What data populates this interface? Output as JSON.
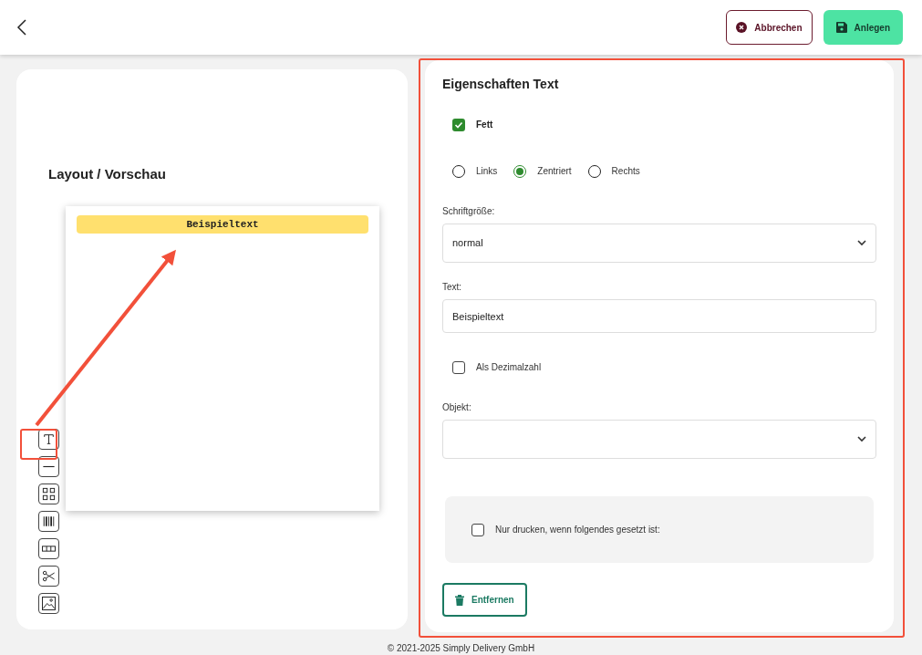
{
  "header": {
    "buttons": [
      {
        "kind": "cancel",
        "label": "Abbrechen"
      },
      {
        "kind": "save",
        "label": "Anlegen"
      }
    ]
  },
  "preview": {
    "title": "Layout / Vorschau",
    "element_text": "Beispieltext",
    "tools": [
      {
        "kind": "text"
      },
      {
        "kind": "line"
      },
      {
        "kind": "qr"
      },
      {
        "kind": "barcode"
      },
      {
        "kind": "table"
      },
      {
        "kind": "cut"
      },
      {
        "kind": "image"
      }
    ]
  },
  "properties": {
    "title": "Eigenschaften Text",
    "bold": {
      "label": "Fett",
      "checked": true
    },
    "alignment": [
      {
        "label": "Links",
        "selected": false
      },
      {
        "label": "Zentriert",
        "selected": true
      },
      {
        "label": "Rechts",
        "selected": false
      }
    ],
    "font_size": {
      "label": "Schriftgröße:",
      "value": "normal"
    },
    "text": {
      "label": "Text:",
      "value": "Beispieltext"
    },
    "decimal": {
      "label": "Als Dezimalzahl",
      "checked": false
    },
    "object": {
      "label": "Objekt:"
    },
    "condition": {
      "label": "Nur drucken, wenn folgendes gesetzt ist:",
      "checked": false
    },
    "remove_button": "Entfernen"
  },
  "footer": "© 2021-2025 Simply Delivery GmbH"
}
